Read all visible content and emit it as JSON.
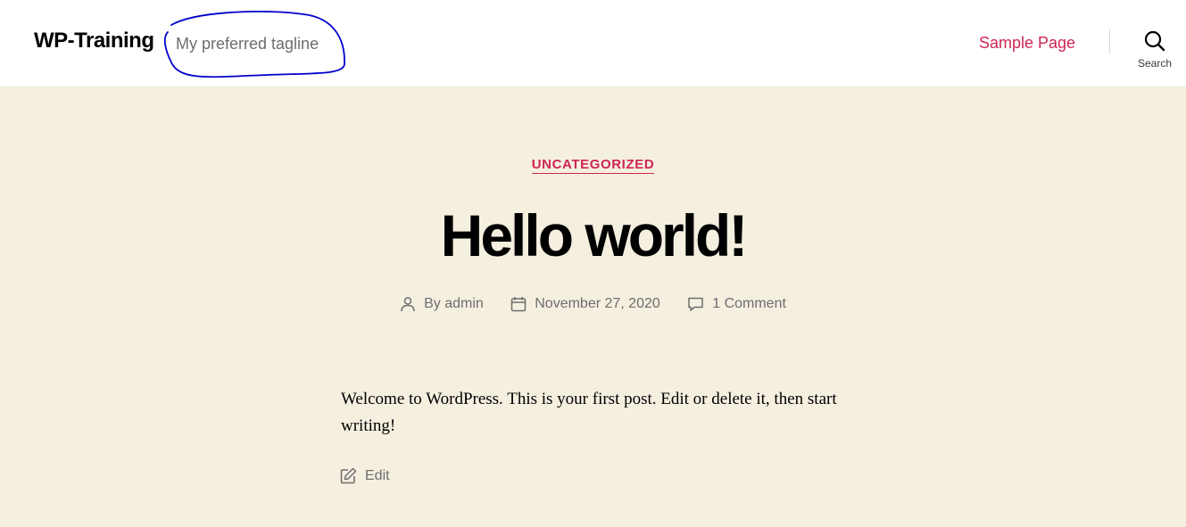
{
  "site": {
    "title": "WP-Training",
    "tagline": "My preferred tagline"
  },
  "nav": {
    "items": [
      {
        "label": "Sample Page"
      }
    ],
    "search_label": "Search"
  },
  "post": {
    "category": "UNCATEGORIZED",
    "title": "Hello world!",
    "meta": {
      "author_prefix": "By",
      "author": "admin",
      "date": "November 27, 2020",
      "comments": "1 Comment"
    },
    "content": "Welcome to WordPress. This is your first post. Edit or delete it, then start writing!",
    "edit_label": "Edit"
  },
  "colors": {
    "accent": "#cd2653",
    "background": "#f5efe0",
    "header_bg": "#ffffff",
    "annotation": "#0000cc"
  },
  "icons": {
    "search": "search-icon",
    "author": "user-icon",
    "date": "calendar-icon",
    "comments": "comment-icon",
    "edit": "edit-icon"
  }
}
